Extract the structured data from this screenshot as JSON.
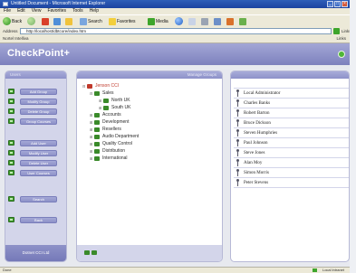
{
  "window": {
    "title": "Untitled Document - Microsoft Internet Explorer"
  },
  "menu": [
    "File",
    "Edit",
    "View",
    "Favorites",
    "Tools",
    "Help"
  ],
  "toolbar": {
    "back": "Back",
    "search": "Search",
    "favorites": "Favorites",
    "media": "Media"
  },
  "address": {
    "label": "Address",
    "url": "http://localhost/dbtcore/index.htm",
    "go": "Go",
    "links": "Links"
  },
  "linksbar": {
    "label": "Nortel Intelliva",
    "right": "Links"
  },
  "app": {
    "logo": "CheckPoint+",
    "left_panel": {
      "header": "Users",
      "group_actions": [
        "Add Group",
        "Modify Group",
        "Delete Group",
        "Group Courses"
      ],
      "user_actions": [
        "Add User",
        "Modify User",
        "Delete User",
        "User Courses"
      ],
      "search": "Search",
      "back": "Back",
      "footer": "Dotnet CCI Ltd"
    },
    "tree_panel": {
      "sort_label": "Manage Groups",
      "items": [
        {
          "label": "Jenson CCI",
          "root": true
        },
        {
          "label": "Sales"
        },
        {
          "label": "North UK"
        },
        {
          "label": "South UK"
        },
        {
          "label": "Accounts"
        },
        {
          "label": "Development"
        },
        {
          "label": "Resellers"
        },
        {
          "label": "Audio Department"
        },
        {
          "label": "Quality Control"
        },
        {
          "label": "Distribution"
        },
        {
          "label": "International"
        }
      ]
    },
    "user_panel": {
      "users": [
        "Local Administrator",
        "Charles Banks",
        "Robert Barton",
        "Bruce Dickson",
        "Steven Humphries",
        "Paul Johnson",
        "Steve Jones",
        "Alan Moy",
        "Simon Morris",
        "Peter Stevens"
      ]
    }
  },
  "status": {
    "left": "Done",
    "right": "Local intranet"
  },
  "colors": {
    "header": "#8d91c9",
    "accent_green": "#3f9a2d",
    "panel_bg": "#d3d5ea"
  }
}
